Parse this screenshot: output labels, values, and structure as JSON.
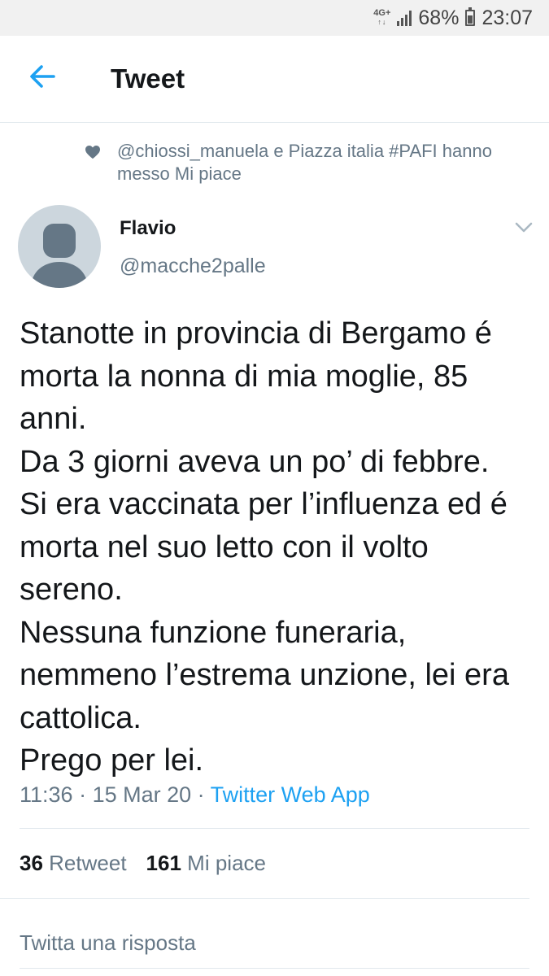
{
  "status_bar": {
    "network": "4G+",
    "battery": "68%",
    "battery_level": 0.68,
    "time": "23:07"
  },
  "header": {
    "title": "Tweet",
    "back_icon": "arrow-left-icon"
  },
  "social_context": {
    "icon": "heart-icon",
    "text": "@chiossi_manuela e Piazza italia #PAFI hanno messo Mi piace"
  },
  "author": {
    "name": "Flavio",
    "handle": "@macche2palle"
  },
  "tweet": {
    "lines": [
      "Stanotte in provincia di Bergamo é morta la nonna di mia moglie, 85 anni.",
      "Da 3 giorni aveva un po’ di febbre.",
      "Si era vaccinata per l’influenza ed é morta nel suo letto con il volto sereno.",
      "Nessuna funzione funeraria, nemmeno l’estrema unzione, lei era cattolica.",
      "Prego per lei."
    ],
    "time": "11:36",
    "separator": " · ",
    "date": "15 Mar 20",
    "source": "Twitter Web App"
  },
  "stats": {
    "retweets": "36",
    "retweets_label": "Retweet",
    "likes": "161",
    "likes_label": "Mi piace"
  },
  "reply": {
    "placeholder": "Twitta una risposta"
  },
  "colors": {
    "accent": "#1da1f2",
    "secondary_text": "#657786",
    "primary_text": "#14171a",
    "divider": "#e1e8ed"
  }
}
